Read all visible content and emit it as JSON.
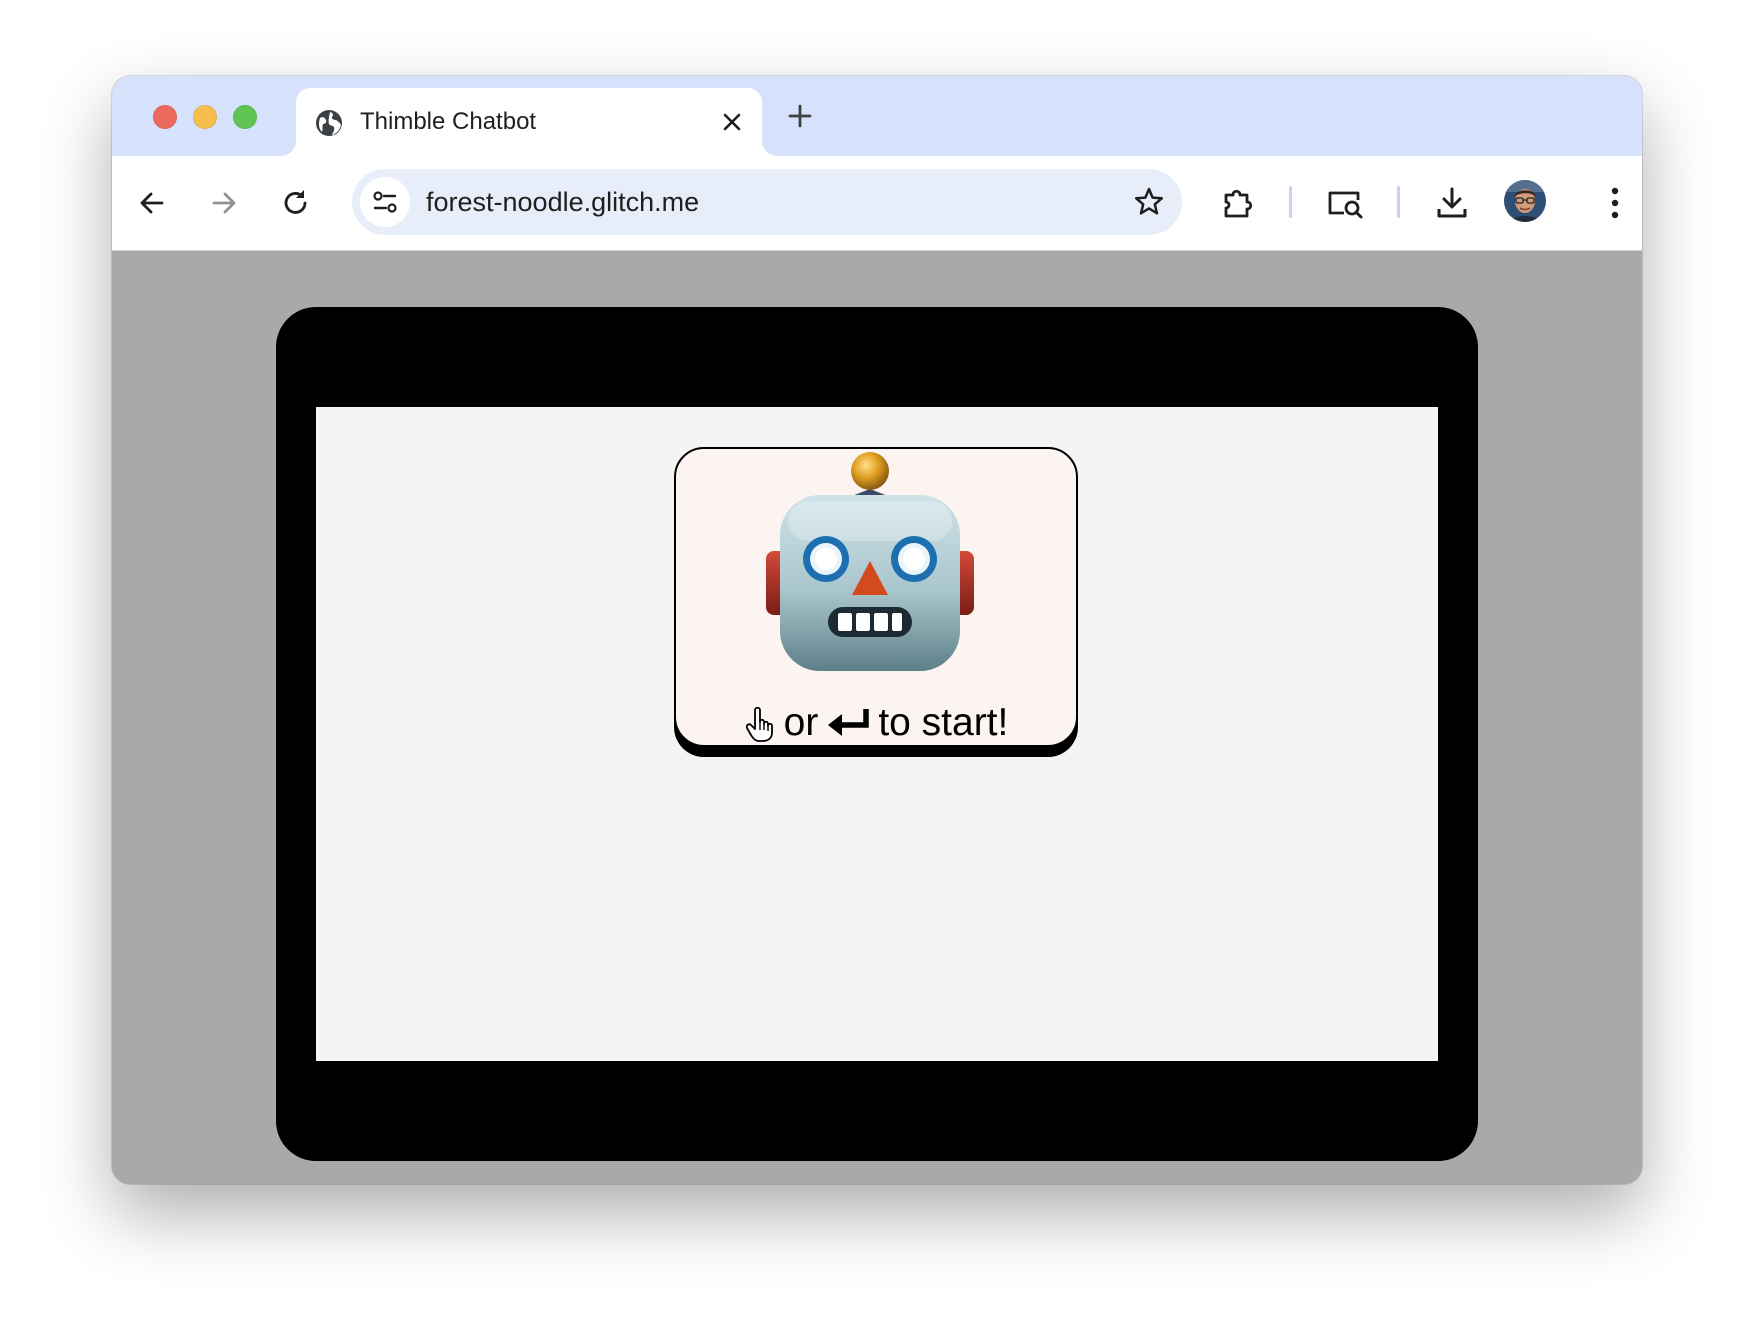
{
  "browser": {
    "tab": {
      "title": "Thimble Chatbot",
      "favicon": "globe-icon"
    },
    "address_bar": {
      "url": "forest-noodle.glitch.me"
    },
    "toolbar_icons": [
      "back-icon",
      "forward-icon",
      "reload-icon",
      "site-info-icon",
      "bookmark-star-icon",
      "extensions-icon",
      "lens-search-icon",
      "download-icon",
      "profile-avatar",
      "menu-kebab-icon"
    ],
    "colors": {
      "titlebar": "#d6e2fb",
      "omnibox": "#e8eef9",
      "page_background": "#a9a9a9"
    }
  },
  "page": {
    "start_card": {
      "icon": "robot-face-emoji",
      "click_icon": "pointing-hand-cursor-icon",
      "text_or": "or",
      "enter_icon": "return-key-icon",
      "text_start": "to start!",
      "background": "#fbf4f0"
    }
  }
}
